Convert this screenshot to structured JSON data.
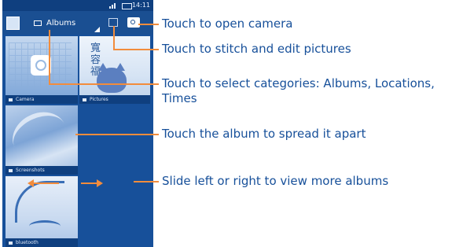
{
  "status_bar": {
    "time": "14:11"
  },
  "action_bar": {
    "albums_label": "Albums"
  },
  "albums": [
    {
      "caption": "Camera"
    },
    {
      "caption": "Pictures"
    },
    {
      "caption": "Screenshots"
    },
    {
      "caption": "bluetooth"
    }
  ],
  "wallpaper_text": "寬容福",
  "callouts": {
    "open_camera": "Touch to open camera",
    "stitch": "Touch to stitch and edit pictures",
    "select_categories_line1": "Touch to select categories: Albums, Locations,",
    "select_categories_line2": "Times",
    "spread_album": "Touch the album to spread it apart",
    "slide": "Slide left or right to view more albums"
  },
  "colors": {
    "accent_orange": "#f28c3c",
    "callout_text": "#17509a",
    "phone_background": "#17509a"
  }
}
